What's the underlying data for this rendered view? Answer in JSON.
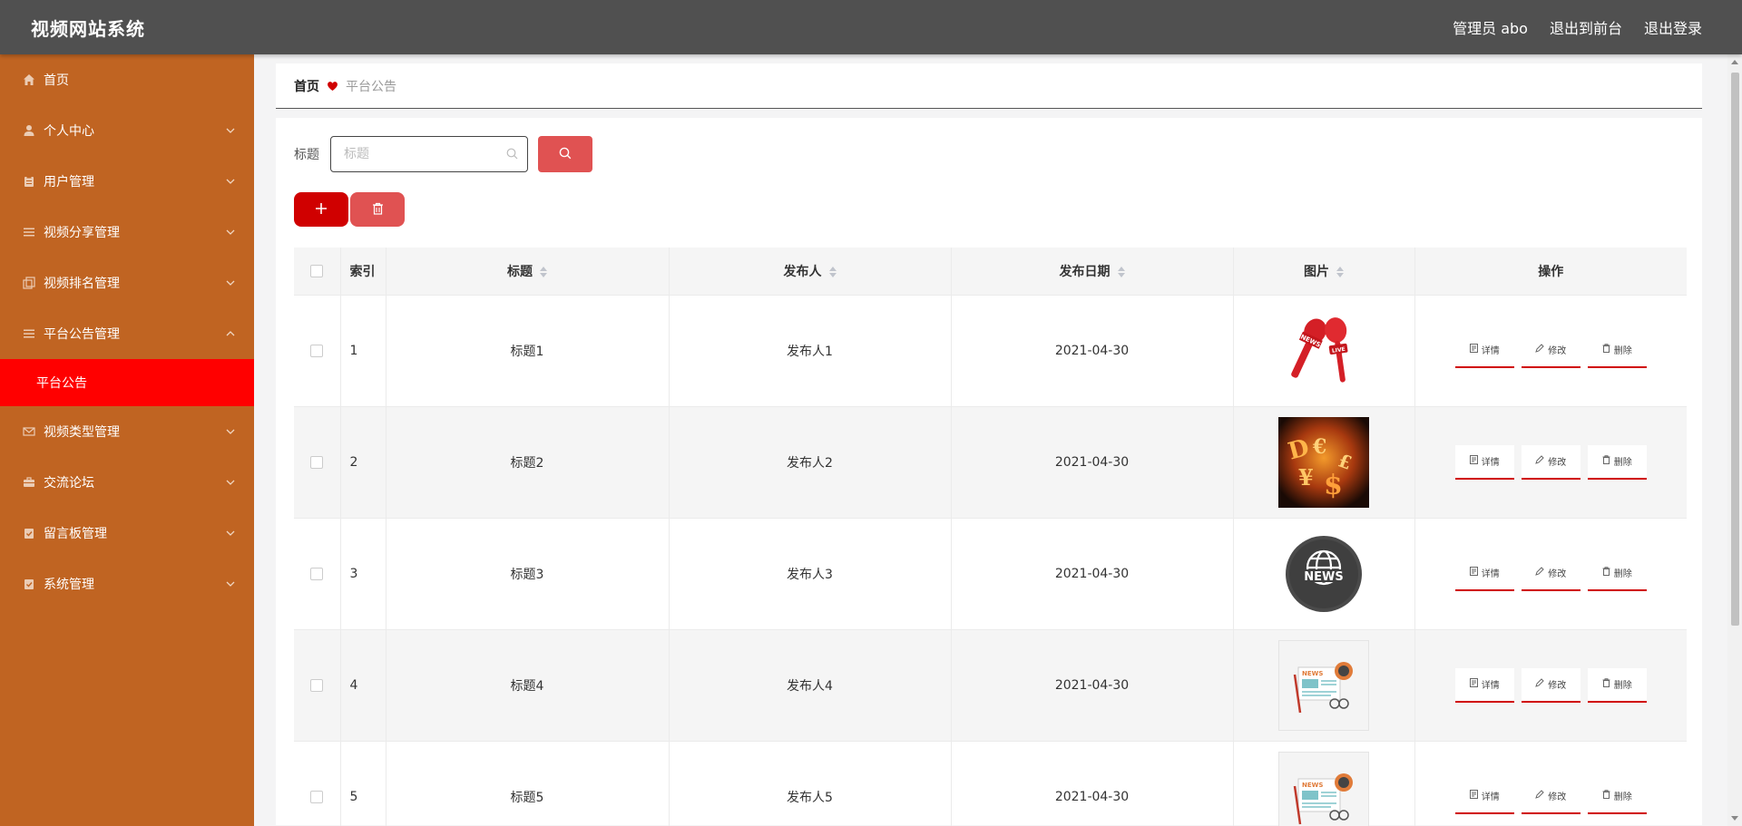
{
  "app": {
    "title": "视频网站系统",
    "user_label": "管理员 abo",
    "frontend_link": "退出到前台",
    "logout_link": "退出登录"
  },
  "sidebar": {
    "items": [
      {
        "label": "首页",
        "icon": "home-icon"
      },
      {
        "label": "个人中心",
        "icon": "user-icon"
      },
      {
        "label": "用户管理",
        "icon": "clipboard-icon"
      },
      {
        "label": "视频分享管理",
        "icon": "list-icon"
      },
      {
        "label": "视频排名管理",
        "icon": "copy-icon"
      },
      {
        "label": "平台公告管理",
        "icon": "list-icon"
      },
      {
        "label": "视频类型管理",
        "icon": "mail-icon"
      },
      {
        "label": "交流论坛",
        "icon": "briefcase-icon"
      },
      {
        "label": "留言板管理",
        "icon": "checklist-icon"
      },
      {
        "label": "系统管理",
        "icon": "checklist-icon"
      }
    ],
    "active_sub": "平台公告"
  },
  "breadcrumb": {
    "home": "首页",
    "current": "平台公告"
  },
  "search": {
    "label": "标题",
    "placeholder": "标题"
  },
  "table": {
    "headers": {
      "index": "索引",
      "title": "标题",
      "publisher": "发布人",
      "date": "发布日期",
      "image": "图片",
      "ops": "操作"
    },
    "rows": [
      {
        "index": "1",
        "title": "标题1",
        "publisher": "发布人1",
        "date": "2021-04-30",
        "image": "microphone-news-image"
      },
      {
        "index": "2",
        "title": "标题2",
        "publisher": "发布人2",
        "date": "2021-04-30",
        "image": "money-symbols-image"
      },
      {
        "index": "3",
        "title": "标题3",
        "publisher": "发布人3",
        "date": "2021-04-30",
        "image": "globe-news-image"
      },
      {
        "index": "4",
        "title": "标题4",
        "publisher": "发布人4",
        "date": "2021-04-30",
        "image": "newspaper-image"
      },
      {
        "index": "5",
        "title": "标题5",
        "publisher": "发布人5",
        "date": "2021-04-30",
        "image": "newspaper-image"
      }
    ],
    "ops": {
      "detail": "详情",
      "edit": "修改",
      "delete": "删除"
    }
  },
  "image_text": {
    "news": "NEWS",
    "live": "LIVE"
  },
  "colors": {
    "topbar": "#505050",
    "sidebar": "#c06422",
    "active": "#ff0000",
    "primary": "#d00000",
    "accent": "#e05252"
  }
}
